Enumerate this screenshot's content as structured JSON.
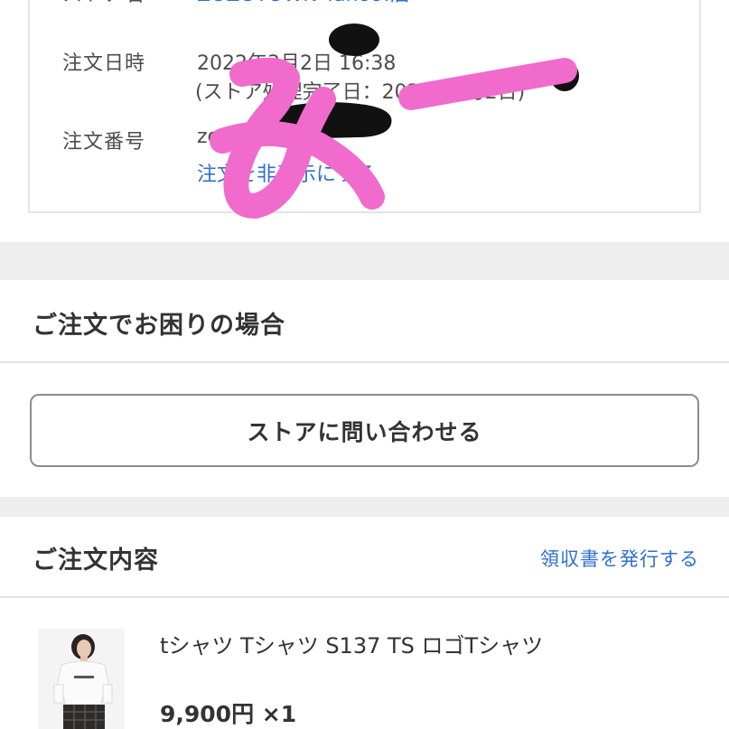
{
  "order_info": {
    "store_label": "ストア名",
    "store_value": "ZOZOTOWN Yahoo!店",
    "date_label": "注文日時",
    "date_value": "2022年3月2日 16:38",
    "process_value": "(ストア処理完了日：2022年3月2日)",
    "number_label": "注文番号",
    "number_value": "zozo-2",
    "hide_link": "注文を非表示にする"
  },
  "help": {
    "title": "ご注文でお困りの場合",
    "contact_button": "ストアに問い合わせる"
  },
  "order_contents": {
    "title": "ご注文内容",
    "receipt_link": "領収書を発行する",
    "item": {
      "name": "tシャツ Tシャツ S137 TS ロゴTシャツ",
      "price": "9,900円 ×1"
    }
  },
  "handwriting": {
    "text": "みー",
    "color": "#f06bcc"
  }
}
